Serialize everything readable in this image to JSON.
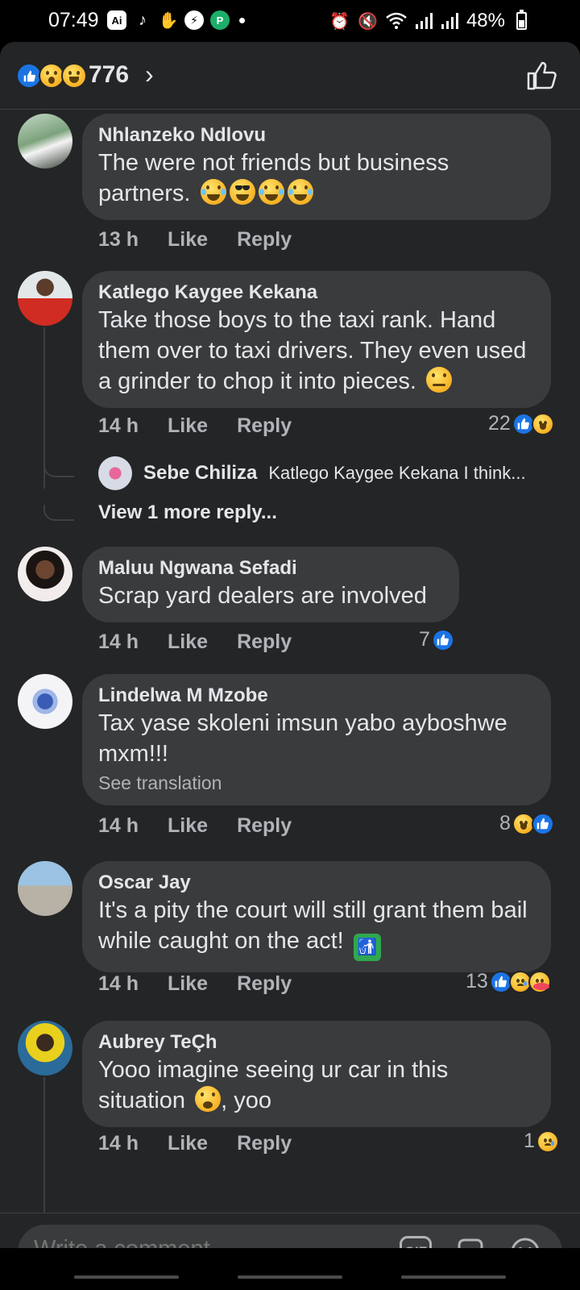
{
  "status_bar": {
    "time": "07:49",
    "ai_badge": "Ai",
    "battery": "48%"
  },
  "reactions_header": {
    "count": "776",
    "chevron": "›",
    "emojis": [
      "like-icon",
      "wow-icon",
      "haha-icon"
    ]
  },
  "comments": [
    {
      "name": "Nhlanzeko Ndlovu",
      "text": "The were not friends but business partners.",
      "emojis": [
        "tears-of-joy",
        "cool",
        "tears-of-joy",
        "tears-of-joy"
      ],
      "time": "13 h",
      "like": "Like",
      "reply": "Reply"
    },
    {
      "name": "Katlego Kaygee Kekana",
      "text": "Take those boys to the taxi rank. Hand them over to taxi drivers. They even used a grinder to chop it into pieces.",
      "emojis": [
        "face-with-raised-eyebrow"
      ],
      "time": "14 h",
      "like": "Like",
      "reply": "Reply",
      "reactions": "22",
      "reply_preview": {
        "name": "Sebe Chiliza",
        "text": "Katlego Kaygee Kekana I think..."
      },
      "view_more": "View 1 more reply..."
    },
    {
      "name": "Maluu Ngwana Sefadi",
      "text": "Scrap yard dealers are involved",
      "time": "14 h",
      "like": "Like",
      "reply": "Reply",
      "reactions": "7"
    },
    {
      "name": "Lindelwa M Mzobe",
      "text": "Tax yase skoleni imsun yabo ayboshwe mxm!!!",
      "see_translation": "See translation",
      "time": "14 h",
      "like": "Like",
      "reply": "Reply",
      "reactions": "8"
    },
    {
      "name": "Oscar Jay",
      "text": "It's a pity the court will still grant them bail while caught on the act!",
      "emojis": [
        "litter-in-bin-sign"
      ],
      "time": "14 h",
      "like": "Like",
      "reply": "Reply",
      "reactions": "13"
    },
    {
      "name": "Aubrey TeÇh",
      "text": "Yooo imagine seeing ur car in this situation",
      "text_after": ",  yoo",
      "emojis": [
        "flushed-face"
      ],
      "time": "14 h",
      "like": "Like",
      "reply": "Reply",
      "reactions": "1"
    }
  ],
  "composer": {
    "placeholder": "Write a comment...",
    "gif_label": "GIF"
  },
  "colors": {
    "background": "#242526",
    "bubble": "#3a3b3c",
    "text": "#e4e6eb",
    "secondary_text": "#b0b3b8",
    "like_blue": "#1b74e4"
  }
}
